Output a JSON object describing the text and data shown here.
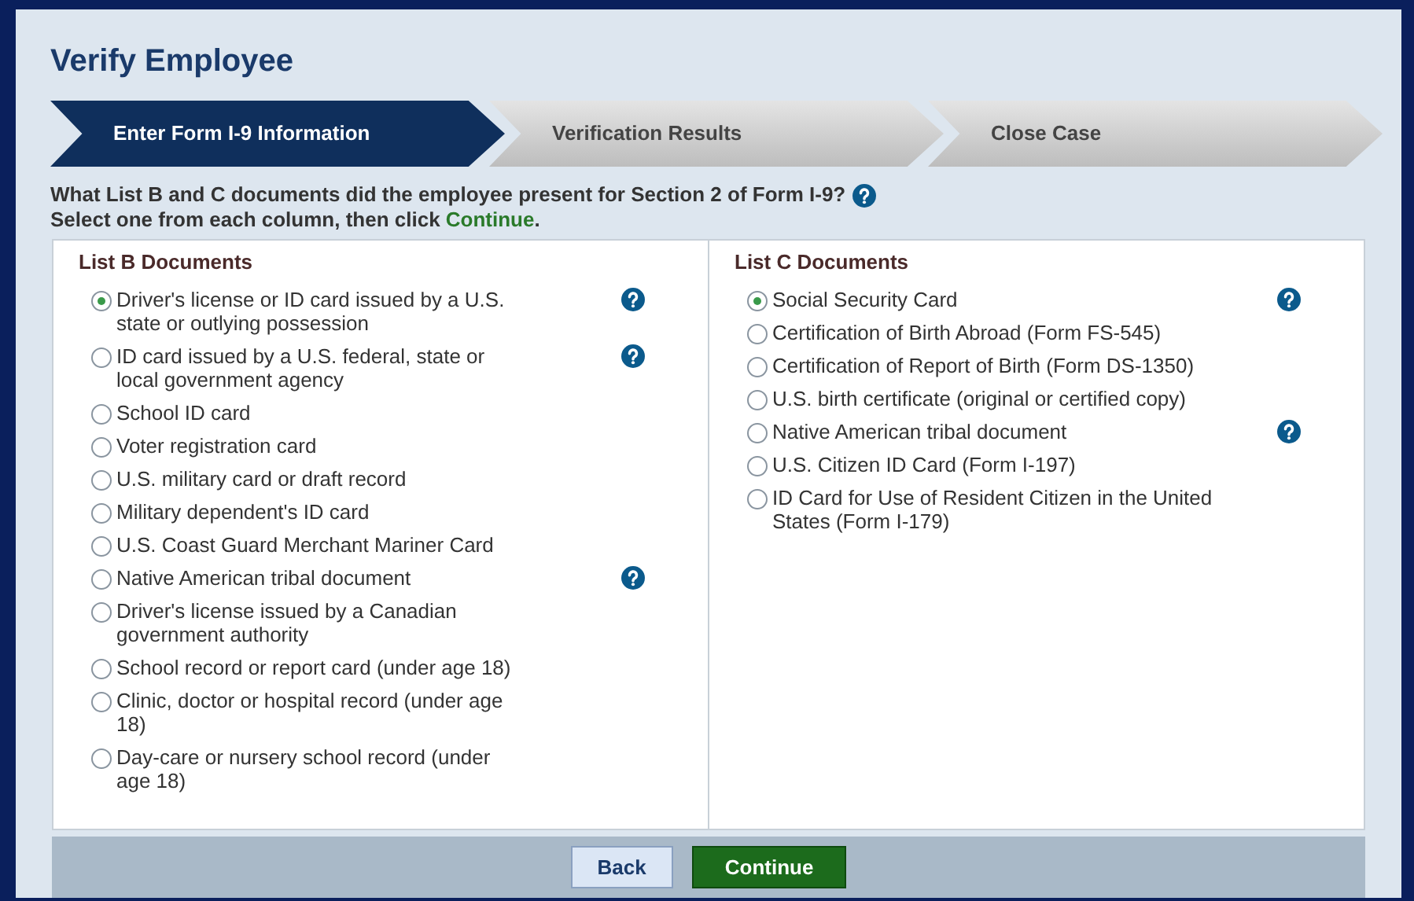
{
  "title": "Verify Employee",
  "steps": [
    {
      "label": "Enter Form I-9 Information",
      "selected": true
    },
    {
      "label": "Verification Results",
      "selected": false
    },
    {
      "label": "Close Case",
      "selected": false
    }
  ],
  "question": "What List B and C documents did the employee present for Section 2 of Form I-9?",
  "instruction": "Select one from each column, then click **Continue**.",
  "lists": [
    {
      "heading": "List B Documents",
      "options": [
        {
          "label": "Driver's license or ID card issued by a U.S. state or outlying possession",
          "selected": true,
          "help": true
        },
        {
          "label": "ID card issued by a U.S. federal, state or local government agency",
          "selected": false,
          "help": true
        },
        {
          "label": "School ID card",
          "selected": false,
          "help": false
        },
        {
          "label": "Voter registration card",
          "selected": false,
          "help": false
        },
        {
          "label": "U.S. military card or draft record",
          "selected": false,
          "help": false
        },
        {
          "label": "Military dependent's ID card",
          "selected": false,
          "help": false
        },
        {
          "label": "U.S. Coast Guard Merchant Mariner Card",
          "selected": false,
          "help": false
        },
        {
          "label": "Native American tribal document",
          "selected": false,
          "help": true
        },
        {
          "label": "Driver's license issued by a Canadian government authority",
          "selected": false,
          "help": false
        },
        {
          "label": "School record or report card (under age 18)",
          "selected": false,
          "help": false
        },
        {
          "label": "Clinic, doctor or hospital record (under age 18)",
          "selected": false,
          "help": false
        },
        {
          "label": "Day-care or nursery school record (under age 18)",
          "selected": false,
          "help": false
        }
      ]
    },
    {
      "heading": "List C Documents",
      "options": [
        {
          "label": "Social Security Card",
          "selected": true,
          "help": true
        },
        {
          "label": "Certification of Birth Abroad (Form FS-545)",
          "selected": false,
          "help": false
        },
        {
          "label": "Certification of Report of Birth (Form DS-1350)",
          "selected": false,
          "help": false
        },
        {
          "label": "U.S. birth certificate (original or certified copy)",
          "selected": false,
          "help": false
        },
        {
          "label": "Native American tribal document",
          "selected": false,
          "help": true
        },
        {
          "label": "U.S. Citizen ID Card (Form I-197)",
          "selected": false,
          "help": false
        },
        {
          "label": "ID Card for Use of Resident Citizen in the United States (Form I-179)",
          "selected": false,
          "help": false
        }
      ]
    }
  ],
  "buttons": [
    {
      "label": "Back",
      "kind": "secondary"
    },
    {
      "label": "Continue",
      "kind": "primary"
    }
  ]
}
